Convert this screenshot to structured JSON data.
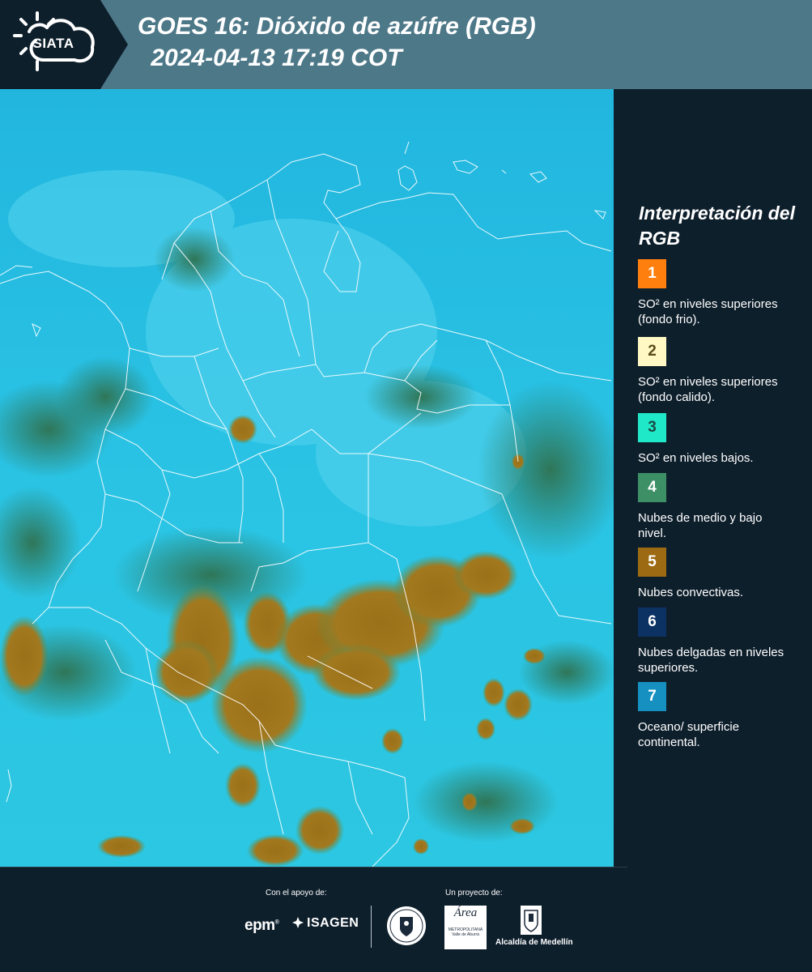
{
  "header": {
    "logo_text": "SIATA",
    "title": "GOES 16: Dióxido de azúfre (RGB)",
    "subtitle": " 2024-04-13 17:19 COT"
  },
  "map": {
    "product": "SO2 RGB composite",
    "dominant_colors": {
      "ocean_surface": "#1dbde6",
      "convective_clouds": "#a07a22",
      "mid_low_clouds": "#3b8a5e",
      "borders": "#ffffff"
    }
  },
  "legend": {
    "title": "Interpretación del RGB",
    "items": [
      {
        "number": "1",
        "label": "SO² en niveles superiores (fondo frio).",
        "color": "#ff7f0e",
        "text_color": "#ffffff"
      },
      {
        "number": "2",
        "label": "SO² en niveles superiores (fondo calido).",
        "color": "#fff8c4",
        "text_color": "#5a4a1a"
      },
      {
        "number": "3",
        "label": "SO² en niveles bajos.",
        "color": "#1fe8c8",
        "text_color": "#1a4a44"
      },
      {
        "number": "4",
        "label": "Nubes de medio y bajo nivel.",
        "color": "#3d8f66",
        "text_color": "#ffffff"
      },
      {
        "number": "5",
        "label": "Nubes convectivas.",
        "color": "#9c6a12",
        "text_color": "#ffffff"
      },
      {
        "number": "6",
        "label": "Nubes delgadas en niveles superiores.",
        "color": "#0c3163",
        "text_color": "#ffffff"
      },
      {
        "number": "7",
        "label": "Oceano/ superficie continental.",
        "color": "#1590c0",
        "text_color": "#ffffff"
      }
    ]
  },
  "footer": {
    "support_label": "Con el apoyo de:",
    "project_label": "Un proyecto de:",
    "epm": "epm",
    "isagen": "ISAGEN",
    "area_name": "Área",
    "area_sub": "METROPOLITANA Valle de Aburrá",
    "alcaldia": "Alcaldía de Medellín"
  }
}
